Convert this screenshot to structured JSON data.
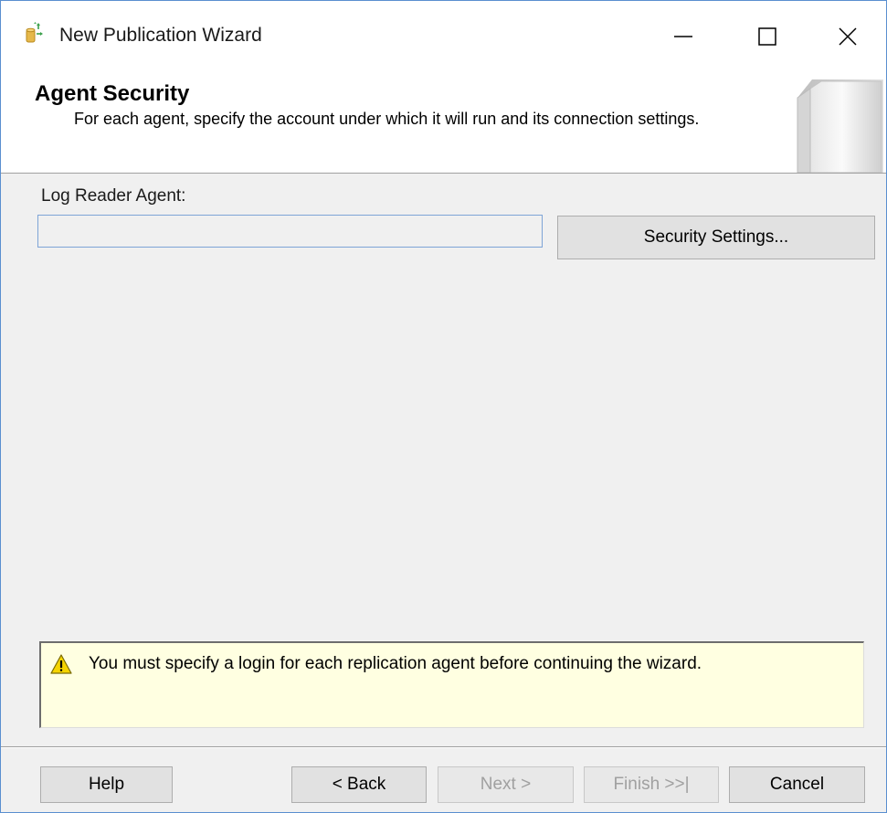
{
  "window": {
    "title": "New Publication Wizard",
    "icon": "publication-wizard-icon"
  },
  "header": {
    "title": "Agent Security",
    "description": "For each agent, specify the account under which it will run and its connection settings."
  },
  "log_reader": {
    "label": "Log Reader Agent:",
    "value": "",
    "security_settings_label": "Security Settings..."
  },
  "message": {
    "icon": "warning-icon",
    "text": "You must specify a login for each replication agent before continuing the wizard."
  },
  "footer": {
    "help_label": "Help",
    "back_label": "< Back",
    "next_label": "Next >",
    "finish_label": "Finish >>|",
    "cancel_label": "Cancel"
  },
  "colors": {
    "message_background": "#ffffe1",
    "window_background": "#f0f0f0",
    "window_border": "#5a8fd0"
  }
}
